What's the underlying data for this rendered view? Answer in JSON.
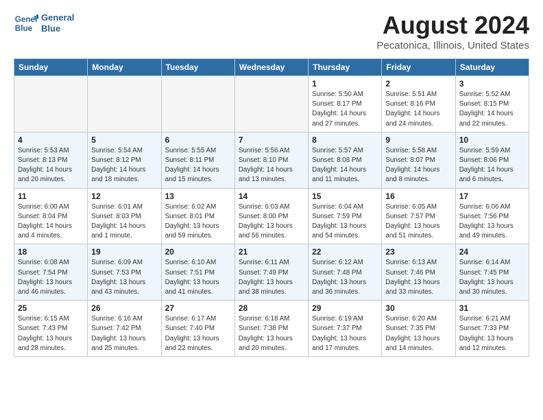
{
  "header": {
    "logo_line1": "General",
    "logo_line2": "Blue",
    "month_title": "August 2024",
    "location": "Pecatonica, Illinois, United States"
  },
  "days_of_week": [
    "Sunday",
    "Monday",
    "Tuesday",
    "Wednesday",
    "Thursday",
    "Friday",
    "Saturday"
  ],
  "weeks": [
    [
      {
        "day": "",
        "info": ""
      },
      {
        "day": "",
        "info": ""
      },
      {
        "day": "",
        "info": ""
      },
      {
        "day": "",
        "info": ""
      },
      {
        "day": "1",
        "info": "Sunrise: 5:50 AM\nSunset: 8:17 PM\nDaylight: 14 hours\nand 27 minutes."
      },
      {
        "day": "2",
        "info": "Sunrise: 5:51 AM\nSunset: 8:16 PM\nDaylight: 14 hours\nand 24 minutes."
      },
      {
        "day": "3",
        "info": "Sunrise: 5:52 AM\nSunset: 8:15 PM\nDaylight: 14 hours\nand 22 minutes."
      }
    ],
    [
      {
        "day": "4",
        "info": "Sunrise: 5:53 AM\nSunset: 8:13 PM\nDaylight: 14 hours\nand 20 minutes."
      },
      {
        "day": "5",
        "info": "Sunrise: 5:54 AM\nSunset: 8:12 PM\nDaylight: 14 hours\nand 18 minutes."
      },
      {
        "day": "6",
        "info": "Sunrise: 5:55 AM\nSunset: 8:11 PM\nDaylight: 14 hours\nand 15 minutes."
      },
      {
        "day": "7",
        "info": "Sunrise: 5:56 AM\nSunset: 8:10 PM\nDaylight: 14 hours\nand 13 minutes."
      },
      {
        "day": "8",
        "info": "Sunrise: 5:57 AM\nSunset: 8:08 PM\nDaylight: 14 hours\nand 11 minutes."
      },
      {
        "day": "9",
        "info": "Sunrise: 5:58 AM\nSunset: 8:07 PM\nDaylight: 14 hours\nand 8 minutes."
      },
      {
        "day": "10",
        "info": "Sunrise: 5:59 AM\nSunset: 8:06 PM\nDaylight: 14 hours\nand 6 minutes."
      }
    ],
    [
      {
        "day": "11",
        "info": "Sunrise: 6:00 AM\nSunset: 8:04 PM\nDaylight: 14 hours\nand 4 minutes."
      },
      {
        "day": "12",
        "info": "Sunrise: 6:01 AM\nSunset: 8:03 PM\nDaylight: 14 hours\nand 1 minute."
      },
      {
        "day": "13",
        "info": "Sunrise: 6:02 AM\nSunset: 8:01 PM\nDaylight: 13 hours\nand 59 minutes."
      },
      {
        "day": "14",
        "info": "Sunrise: 6:03 AM\nSunset: 8:00 PM\nDaylight: 13 hours\nand 56 minutes."
      },
      {
        "day": "15",
        "info": "Sunrise: 6:04 AM\nSunset: 7:59 PM\nDaylight: 13 hours\nand 54 minutes."
      },
      {
        "day": "16",
        "info": "Sunrise: 6:05 AM\nSunset: 7:57 PM\nDaylight: 13 hours\nand 51 minutes."
      },
      {
        "day": "17",
        "info": "Sunrise: 6:06 AM\nSunset: 7:56 PM\nDaylight: 13 hours\nand 49 minutes."
      }
    ],
    [
      {
        "day": "18",
        "info": "Sunrise: 6:08 AM\nSunset: 7:54 PM\nDaylight: 13 hours\nand 46 minutes."
      },
      {
        "day": "19",
        "info": "Sunrise: 6:09 AM\nSunset: 7:53 PM\nDaylight: 13 hours\nand 43 minutes."
      },
      {
        "day": "20",
        "info": "Sunrise: 6:10 AM\nSunset: 7:51 PM\nDaylight: 13 hours\nand 41 minutes."
      },
      {
        "day": "21",
        "info": "Sunrise: 6:11 AM\nSunset: 7:49 PM\nDaylight: 13 hours\nand 38 minutes."
      },
      {
        "day": "22",
        "info": "Sunrise: 6:12 AM\nSunset: 7:48 PM\nDaylight: 13 hours\nand 36 minutes."
      },
      {
        "day": "23",
        "info": "Sunrise: 6:13 AM\nSunset: 7:46 PM\nDaylight: 13 hours\nand 33 minutes."
      },
      {
        "day": "24",
        "info": "Sunrise: 6:14 AM\nSunset: 7:45 PM\nDaylight: 13 hours\nand 30 minutes."
      }
    ],
    [
      {
        "day": "25",
        "info": "Sunrise: 6:15 AM\nSunset: 7:43 PM\nDaylight: 13 hours\nand 28 minutes."
      },
      {
        "day": "26",
        "info": "Sunrise: 6:16 AM\nSunset: 7:42 PM\nDaylight: 13 hours\nand 25 minutes."
      },
      {
        "day": "27",
        "info": "Sunrise: 6:17 AM\nSunset: 7:40 PM\nDaylight: 13 hours\nand 22 minutes."
      },
      {
        "day": "28",
        "info": "Sunrise: 6:18 AM\nSunset: 7:38 PM\nDaylight: 13 hours\nand 20 minutes."
      },
      {
        "day": "29",
        "info": "Sunrise: 6:19 AM\nSunset: 7:37 PM\nDaylight: 13 hours\nand 17 minutes."
      },
      {
        "day": "30",
        "info": "Sunrise: 6:20 AM\nSunset: 7:35 PM\nDaylight: 13 hours\nand 14 minutes."
      },
      {
        "day": "31",
        "info": "Sunrise: 6:21 AM\nSunset: 7:33 PM\nDaylight: 13 hours\nand 12 minutes."
      }
    ]
  ]
}
